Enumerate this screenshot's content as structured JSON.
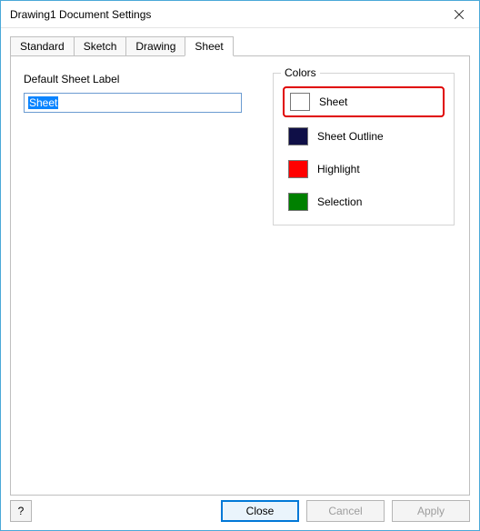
{
  "window": {
    "title": "Drawing1 Document Settings"
  },
  "tabs": {
    "standard": "Standard",
    "sketch": "Sketch",
    "drawing": "Drawing",
    "sheet": "Sheet"
  },
  "sheet_panel": {
    "default_label_caption": "Default Sheet Label",
    "default_label_value": "Sheet"
  },
  "colors": {
    "legend": "Colors",
    "items": [
      {
        "swatch": "#ffffff",
        "label": "Sheet"
      },
      {
        "swatch": "#0f0f47",
        "label": "Sheet Outline"
      },
      {
        "swatch": "#ff0000",
        "label": "Highlight"
      },
      {
        "swatch": "#008000",
        "label": "Selection"
      }
    ]
  },
  "footer": {
    "help": "?",
    "close": "Close",
    "cancel": "Cancel",
    "apply": "Apply"
  }
}
